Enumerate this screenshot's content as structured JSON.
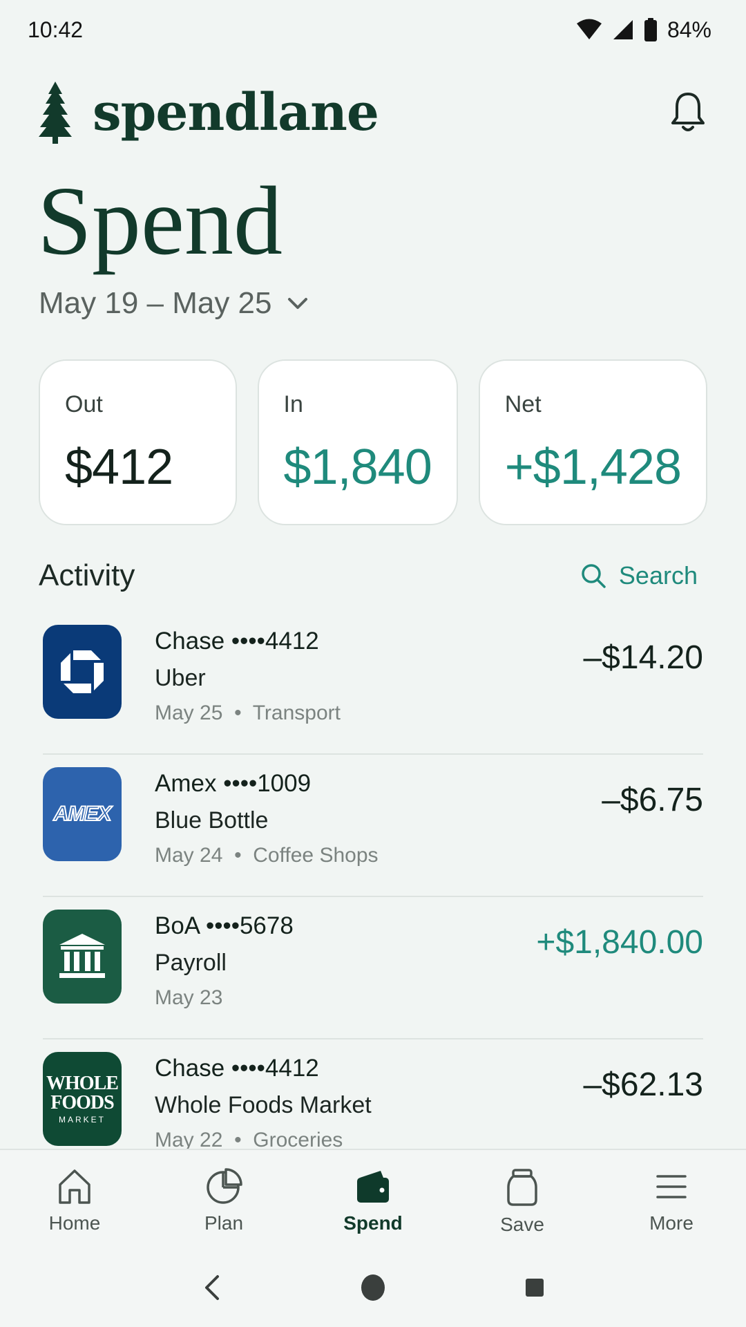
{
  "status_bar": {
    "time": "10:42",
    "battery": "84%"
  },
  "header": {
    "brand": "spendlane"
  },
  "page": {
    "title": "Spend",
    "date_range": "May 19 – May 25"
  },
  "summary": [
    {
      "label": "Out",
      "value": "$412"
    },
    {
      "label": "In",
      "value": "$1,840"
    },
    {
      "label": "Net",
      "value": "+$1,428"
    }
  ],
  "activity": {
    "title": "Activity",
    "search_label": "Search"
  },
  "transactions": [
    {
      "account": "Chase ••••4412",
      "merchant": "Uber",
      "date": "May 25",
      "category": "Transport",
      "amount": "–$14.20"
    },
    {
      "account": "Amex ••••1009",
      "merchant": "Blue Bottle",
      "date": "May 24",
      "category": "Coffee Shops",
      "amount": "–$6.75",
      "logo_text": "AMEX"
    },
    {
      "account": "BoA ••••5678",
      "merchant": "Payroll",
      "date": "May 23",
      "category": "",
      "amount": "+$1,840.00"
    },
    {
      "account": "Chase ••••4412",
      "merchant": "Whole Foods Market",
      "date": "May 22",
      "category": "Groceries",
      "amount": "–$62.13",
      "logo_line1": "WHOLE",
      "logo_line2": "FOODS",
      "logo_line3": "MARKET"
    }
  ],
  "nav": [
    {
      "label": "Home",
      "icon": "home-icon"
    },
    {
      "label": "Plan",
      "icon": "pie-chart-icon"
    },
    {
      "label": "Spend",
      "icon": "wallet-icon"
    },
    {
      "label": "Save",
      "icon": "jar-icon"
    },
    {
      "label": "More",
      "icon": "menu-icon"
    }
  ],
  "colors": {
    "brand": "#123a2b",
    "accent": "#1f8a7c",
    "chase": "#0a3a78",
    "amex": "#2d63ad",
    "boa": "#1b5c44",
    "wholefoods": "#0f4a34"
  }
}
